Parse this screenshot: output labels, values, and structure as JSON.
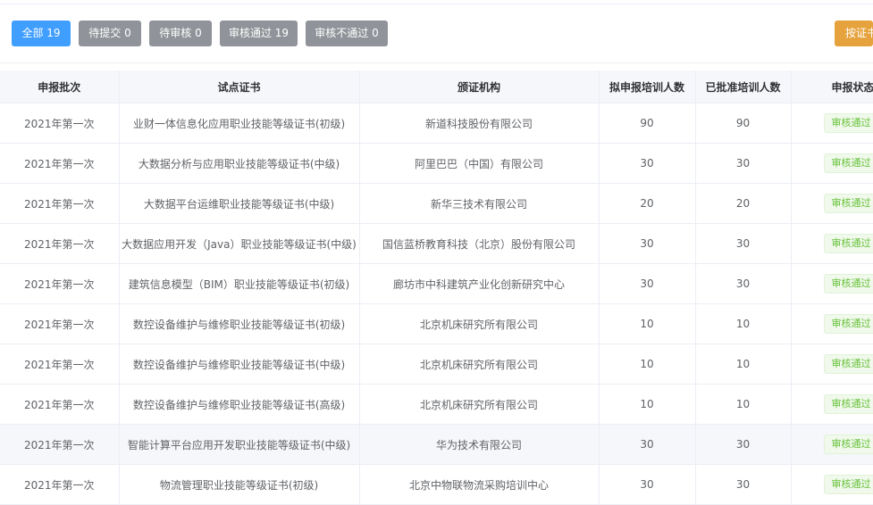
{
  "filters": {
    "all": "全部 19",
    "pending_submit": "待提交 0",
    "pending_review": "待审核 0",
    "approved": "审核通过 19",
    "rejected": "审核不通过 0",
    "by_cert": "按证书"
  },
  "colors": {
    "primary": "#409eff",
    "gray_button": "#909399",
    "warning": "#e6a23c",
    "success_text": "#67c23a",
    "success_bg": "#f0f9eb"
  },
  "table": {
    "headers": [
      "申报批次",
      "试点证书",
      "颁证机构",
      "拟申报培训人数",
      "已批准培训人数",
      "申报状态"
    ],
    "rows": [
      {
        "batch": "2021年第一次",
        "cert": "业财一体信息化应用职业技能等级证书(初级)",
        "org": "新道科技股份有限公司",
        "planned": "90",
        "approved": "90",
        "status": "审核通过"
      },
      {
        "batch": "2021年第一次",
        "cert": "大数据分析与应用职业技能等级证书(中级)",
        "org": "阿里巴巴（中国）有限公司",
        "planned": "30",
        "approved": "30",
        "status": "审核通过"
      },
      {
        "batch": "2021年第一次",
        "cert": "大数据平台运维职业技能等级证书(中级)",
        "org": "新华三技术有限公司",
        "planned": "20",
        "approved": "20",
        "status": "审核通过"
      },
      {
        "batch": "2021年第一次",
        "cert": "大数据应用开发（Java）职业技能等级证书(中级)",
        "org": "国信蓝桥教育科技（北京）股份有限公司",
        "planned": "30",
        "approved": "30",
        "status": "审核通过"
      },
      {
        "batch": "2021年第一次",
        "cert": "建筑信息模型（BIM）职业技能等级证书(初级)",
        "org": "廊坊市中科建筑产业化创新研究中心",
        "planned": "30",
        "approved": "30",
        "status": "审核通过"
      },
      {
        "batch": "2021年第一次",
        "cert": "数控设备维护与维修职业技能等级证书(初级)",
        "org": "北京机床研究所有限公司",
        "planned": "10",
        "approved": "10",
        "status": "审核通过"
      },
      {
        "batch": "2021年第一次",
        "cert": "数控设备维护与维修职业技能等级证书(中级)",
        "org": "北京机床研究所有限公司",
        "planned": "10",
        "approved": "10",
        "status": "审核通过"
      },
      {
        "batch": "2021年第一次",
        "cert": "数控设备维护与维修职业技能等级证书(高级)",
        "org": "北京机床研究所有限公司",
        "planned": "10",
        "approved": "10",
        "status": "审核通过"
      },
      {
        "batch": "2021年第一次",
        "cert": "智能计算平台应用开发职业技能等级证书(中级)",
        "org": "华为技术有限公司",
        "planned": "30",
        "approved": "30",
        "status": "审核通过"
      },
      {
        "batch": "2021年第一次",
        "cert": "物流管理职业技能等级证书(初级)",
        "org": "北京中物联物流采购培训中心",
        "planned": "30",
        "approved": "30",
        "status": "审核通过"
      }
    ]
  }
}
